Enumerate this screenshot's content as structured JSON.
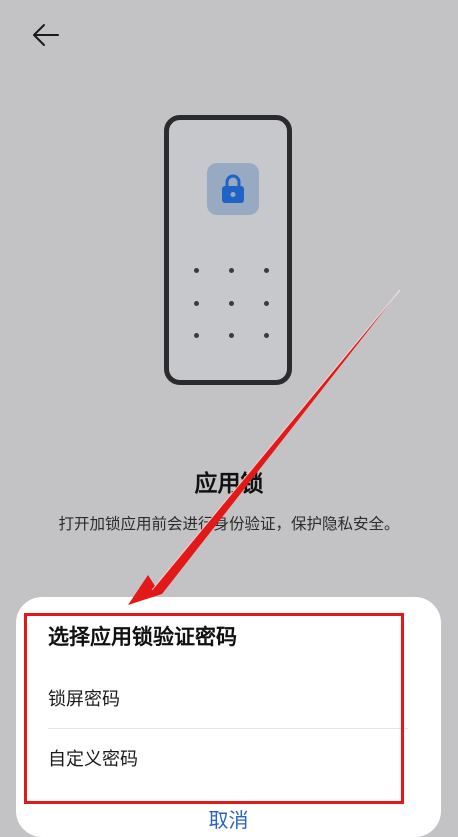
{
  "header": {
    "back_icon": "arrow-left-icon"
  },
  "illustration": {
    "lock_icon": "lock-icon",
    "tile_color": "#98a9c2",
    "lock_color": "#1f63c6"
  },
  "intro": {
    "title": "应用锁",
    "description": "打开加锁应用前会进行身份验证，保护隐私安全。"
  },
  "sheet": {
    "title": "选择应用锁验证密码",
    "options": [
      {
        "label": "锁屏密码"
      },
      {
        "label": "自定义密码"
      }
    ],
    "cancel_label": "取消"
  },
  "annotation": {
    "color": "#e31818"
  }
}
